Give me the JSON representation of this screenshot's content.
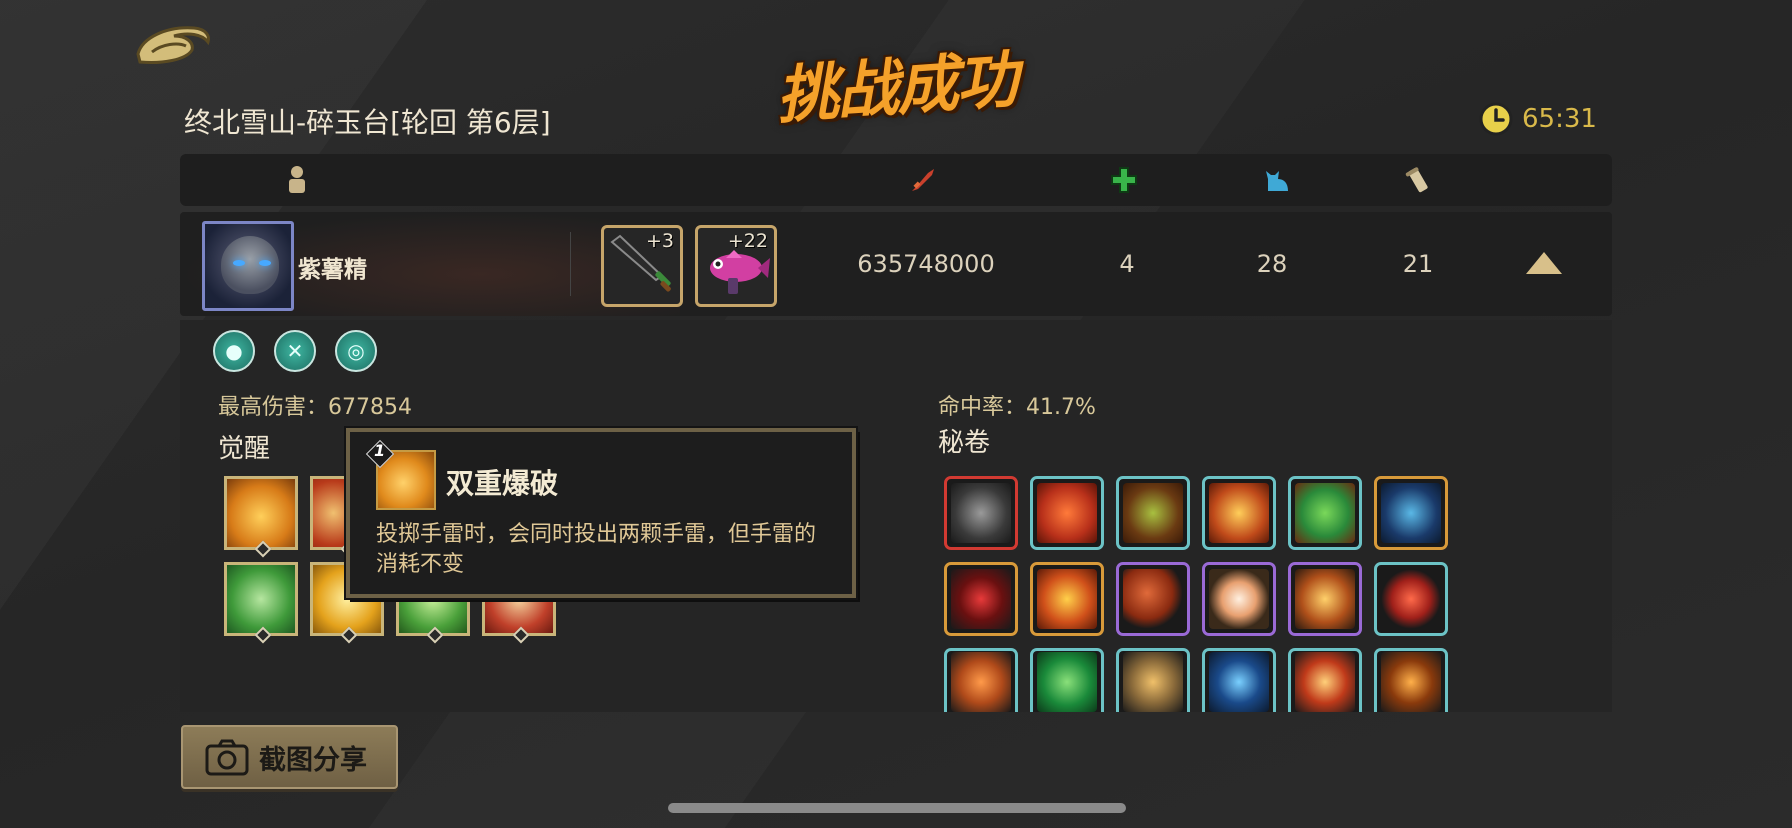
{
  "header": {
    "title": "挑战成功",
    "stage": "终北雪山-碎玉台[轮回 第6层]",
    "timer": "65:31"
  },
  "columns": {
    "icons": [
      "player-icon",
      "damage-icon",
      "heal-icon",
      "pet-icon",
      "scroll-icon"
    ]
  },
  "player": {
    "name": "紫薯精",
    "weapons": [
      {
        "level": "+3",
        "icon": "dagger-icon"
      },
      {
        "level": "+22",
        "icon": "fish-gun-icon"
      }
    ],
    "damage": "635748000",
    "heal": "4",
    "pet": "28",
    "scrolls": "21"
  },
  "details": {
    "max_damage_label": "最高伤害：677854",
    "hit_rate_label": "命中率：41.7%",
    "awaken_title": "觉醒",
    "scroll_title": "秘卷",
    "buff_icons": [
      "bomb-buff-icon",
      "blade-buff-icon",
      "vortex-buff-icon"
    ]
  },
  "tooltip": {
    "level": "1",
    "title": "双重爆破",
    "description": "投掷手雷时，会同时投出两颗手雷，但手雷的消耗不变"
  },
  "share": {
    "label": "截图分享"
  },
  "colors": {
    "accent": "#f5a12a",
    "gold_border": "#c6a56a",
    "teal_frame": "#6cc3c6",
    "red_frame": "#d23a32",
    "orange_frame": "#d89a3a",
    "purple_frame": "#9a6ad6"
  }
}
